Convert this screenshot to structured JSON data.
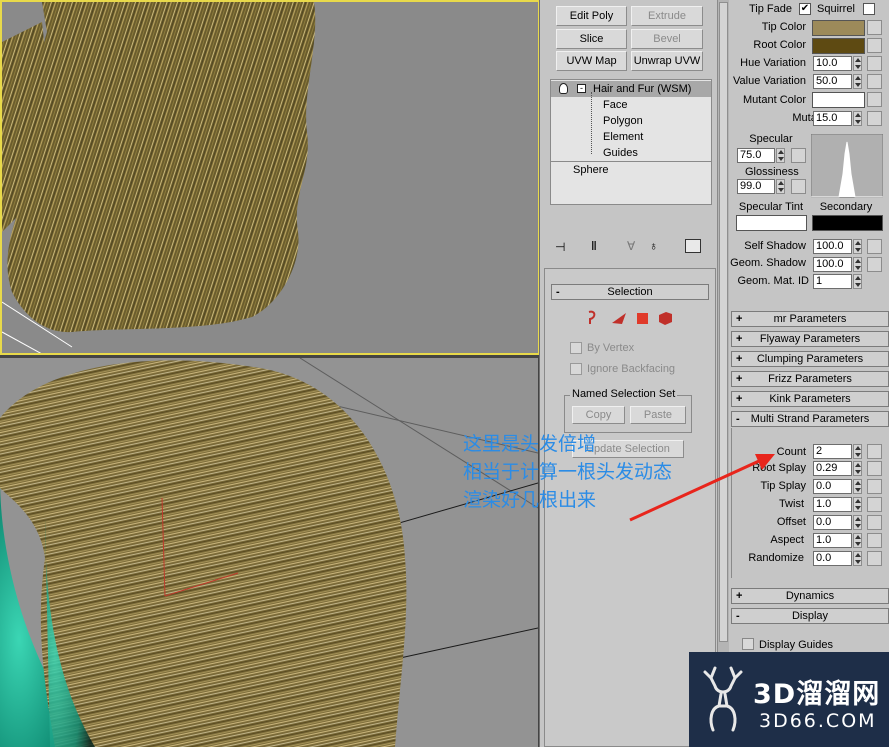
{
  "modifier_buttons": {
    "edit_poly": "Edit Poly",
    "extrude": "Extrude",
    "slice": "Slice",
    "bevel": "Bevel",
    "uvw_map": "UVW Map",
    "unwrap_uvw": "Unwrap UVW"
  },
  "stack": {
    "modifier": "Hair and Fur (WSM)",
    "sub": [
      "Face",
      "Polygon",
      "Element",
      "Guides"
    ],
    "base": "Sphere"
  },
  "selection": {
    "title": "Selection",
    "by_vertex": "By Vertex",
    "ignore_backfacing": "Ignore Backfacing",
    "named_set": "Named Selection Set",
    "copy": "Copy",
    "paste": "Paste",
    "update": "Update Selection",
    "collapse": "-"
  },
  "material": {
    "tip_fade": "Tip Fade",
    "squirrel": "Squirrel",
    "tip_fade_checked": true,
    "squirrel_checked": false,
    "tip_color": "Tip Color",
    "tip_color_hex": "#9c8a5a",
    "root_color": "Root Color",
    "root_color_hex": "#5e4a12",
    "hue_variation": "Hue Variation",
    "hue_variation_value": "10.0",
    "value_variation": "Value Variation",
    "value_variation_value": "50.0",
    "mutant_color": "Mutant Color",
    "mutant_color_hex": "#ffffff",
    "mutant": "Mutant",
    "mutant_value": "15.0",
    "specular": "Specular",
    "specular_value": "75.0",
    "glossiness": "Glossiness",
    "glossiness_value": "99.0",
    "specular_tint": "Specular Tint",
    "secondary": "Secondary",
    "specular_tint_hex": "#ffffff",
    "secondary_hex": "#000000",
    "self_shadow": "Self Shadow",
    "self_shadow_value": "100.0",
    "geom_shadow": "Geom. Shadow",
    "geom_shadow_value": "100.0",
    "geom_mat_id": "Geom. Mat. ID",
    "geom_mat_id_value": "1"
  },
  "rollouts": [
    {
      "sign": "+",
      "label": "mr Parameters"
    },
    {
      "sign": "+",
      "label": "Flyaway Parameters"
    },
    {
      "sign": "+",
      "label": "Clumping Parameters"
    },
    {
      "sign": "+",
      "label": "Frizz Parameters"
    },
    {
      "sign": "+",
      "label": "Kink Parameters"
    },
    {
      "sign": "-",
      "label": "Multi Strand Parameters"
    }
  ],
  "multi_strand": [
    {
      "label": "Count",
      "value": "2"
    },
    {
      "label": "Root Splay",
      "value": "0.29"
    },
    {
      "label": "Tip Splay",
      "value": "0.0"
    },
    {
      "label": "Twist",
      "value": "1.0"
    },
    {
      "label": "Offset",
      "value": "0.0"
    },
    {
      "label": "Aspect",
      "value": "1.0"
    },
    {
      "label": "Randomize",
      "value": "0.0"
    }
  ],
  "dynamics": {
    "sign": "+",
    "label": "Dynamics"
  },
  "display": {
    "sign": "-",
    "label": "Display",
    "display_guides": "Display Guides"
  },
  "annotation": [
    "这里是头发倍增",
    "相当于计算一根头发动态",
    "渲染好几根出来"
  ],
  "watermark": {
    "title": "3D溜溜网",
    "url": "3D66.COM"
  },
  "colors": {
    "accent_annotation": "#2b8ce6",
    "viewport_border": "#e8d94a",
    "arrow": "#e8251c"
  }
}
